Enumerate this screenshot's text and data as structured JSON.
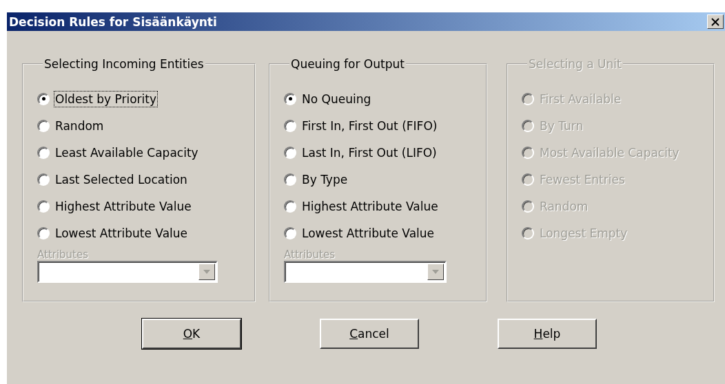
{
  "window": {
    "title": "Decision Rules for Sisäänkäynti"
  },
  "groups": [
    {
      "title": "Selecting Incoming Entities",
      "disabled": false,
      "options": [
        {
          "label": "Oldest by Priority",
          "selected": true,
          "focused": true
        },
        {
          "label": "Random",
          "selected": false,
          "focused": false
        },
        {
          "label": "Least Available Capacity",
          "selected": false,
          "focused": false
        },
        {
          "label": "Last Selected Location",
          "selected": false,
          "focused": false
        },
        {
          "label": "Highest Attribute Value",
          "selected": false,
          "focused": false
        },
        {
          "label": "Lowest Attribute Value",
          "selected": false,
          "focused": false
        }
      ],
      "attributes": {
        "label": "Attributes",
        "disabled": true
      }
    },
    {
      "title": "Queuing for Output",
      "disabled": false,
      "options": [
        {
          "label": "No Queuing",
          "selected": true,
          "focused": false
        },
        {
          "label": "First In, First Out (FIFO)",
          "selected": false,
          "focused": false
        },
        {
          "label": "Last In, First Out (LIFO)",
          "selected": false,
          "focused": false
        },
        {
          "label": "By Type",
          "selected": false,
          "focused": false
        },
        {
          "label": "Highest Attribute Value",
          "selected": false,
          "focused": false
        },
        {
          "label": "Lowest Attribute Value",
          "selected": false,
          "focused": false
        }
      ],
      "attributes": {
        "label": "Attributes",
        "disabled": true
      }
    },
    {
      "title": "Selecting a Unit",
      "disabled": true,
      "options": [
        {
          "label": "First Available",
          "selected": false,
          "focused": false
        },
        {
          "label": "By Turn",
          "selected": false,
          "focused": false
        },
        {
          "label": "Most Available Capacity",
          "selected": false,
          "focused": false
        },
        {
          "label": "Fewest Entries",
          "selected": false,
          "focused": false
        },
        {
          "label": "Random",
          "selected": false,
          "focused": false
        },
        {
          "label": "Longest Empty",
          "selected": false,
          "focused": false
        }
      ]
    }
  ],
  "buttons": [
    {
      "label": "OK",
      "default": true
    },
    {
      "label": "Cancel",
      "default": false
    },
    {
      "label": "Help",
      "default": false
    }
  ]
}
